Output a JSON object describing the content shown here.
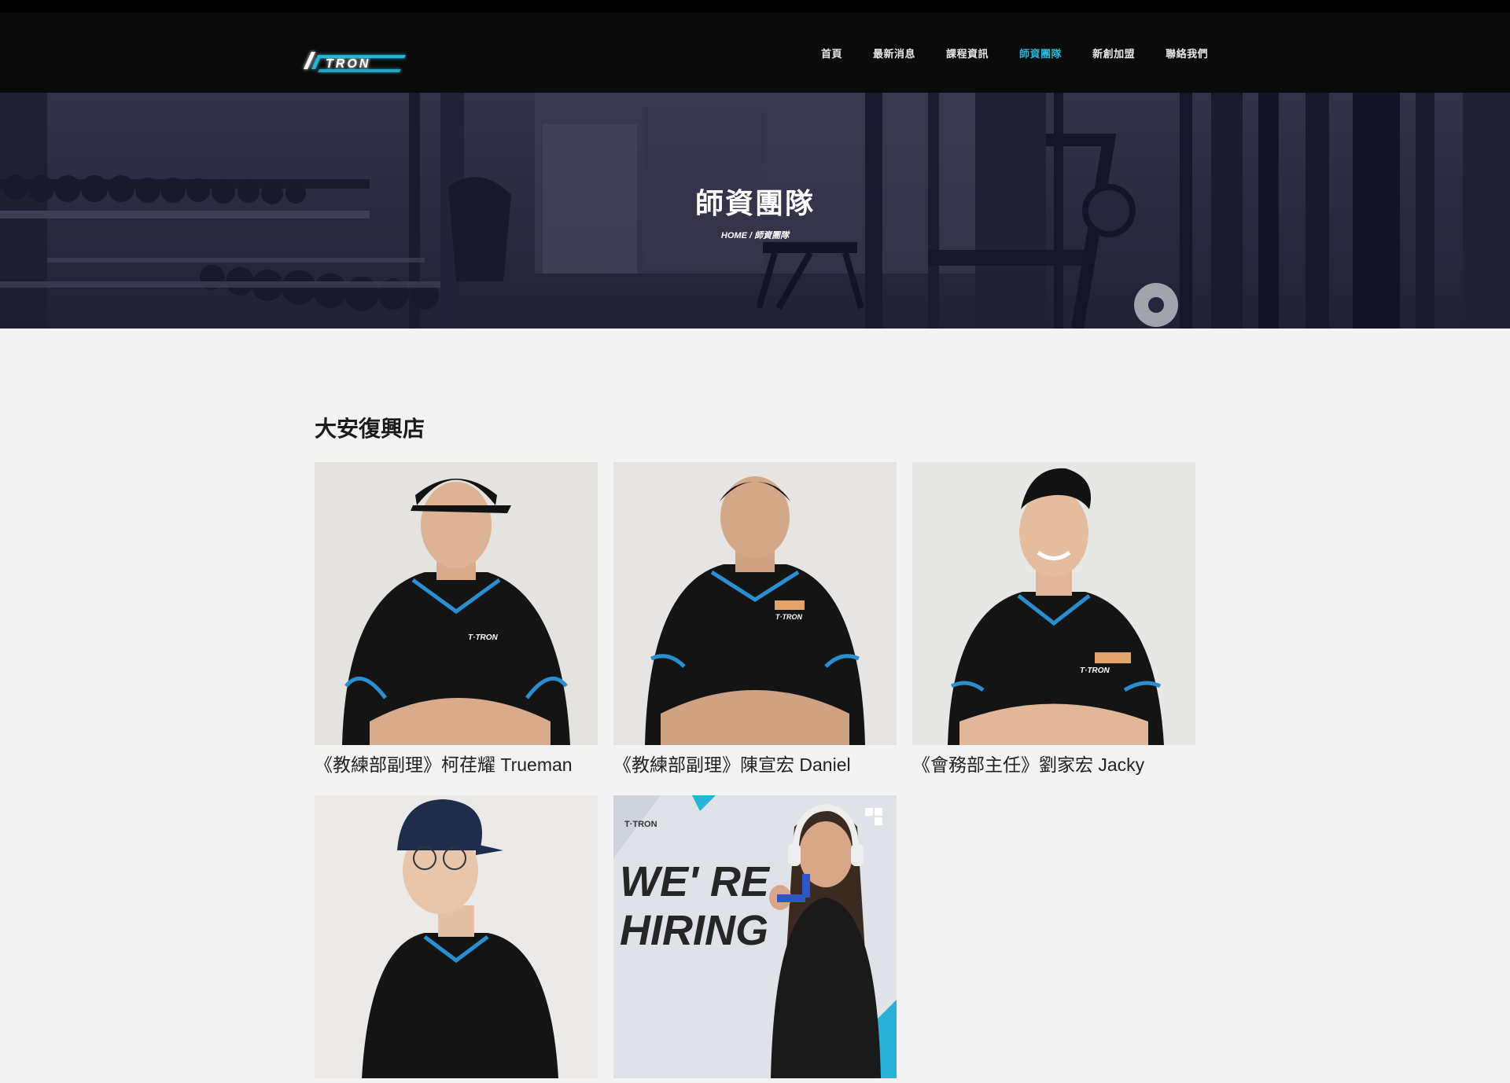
{
  "brand": {
    "logo_text": "TRON"
  },
  "nav": {
    "items": [
      {
        "label": "首頁"
      },
      {
        "label": "最新消息"
      },
      {
        "label": "課程資訊"
      },
      {
        "label": "師資團隊",
        "active": true
      },
      {
        "label": "新創加盟"
      },
      {
        "label": "聯絡我們"
      }
    ],
    "accent_color": "#2ab3d6"
  },
  "hero": {
    "title": "師資團隊",
    "breadcrumb_home": "HOME",
    "breadcrumb_sep": " / ",
    "breadcrumb_current": "師資團隊"
  },
  "section": {
    "title": "大安復興店"
  },
  "coaches": [
    {
      "caption": "《教練部副理》柯荏耀 Trueman"
    },
    {
      "caption": "《教練部副理》陳宣宏 Daniel"
    },
    {
      "caption": "《會務部主任》劉家宏 Jacky"
    },
    {
      "caption": ""
    },
    {
      "caption": "",
      "banner_text_1": "WE' RE",
      "banner_text_2": "HIRING"
    }
  ]
}
